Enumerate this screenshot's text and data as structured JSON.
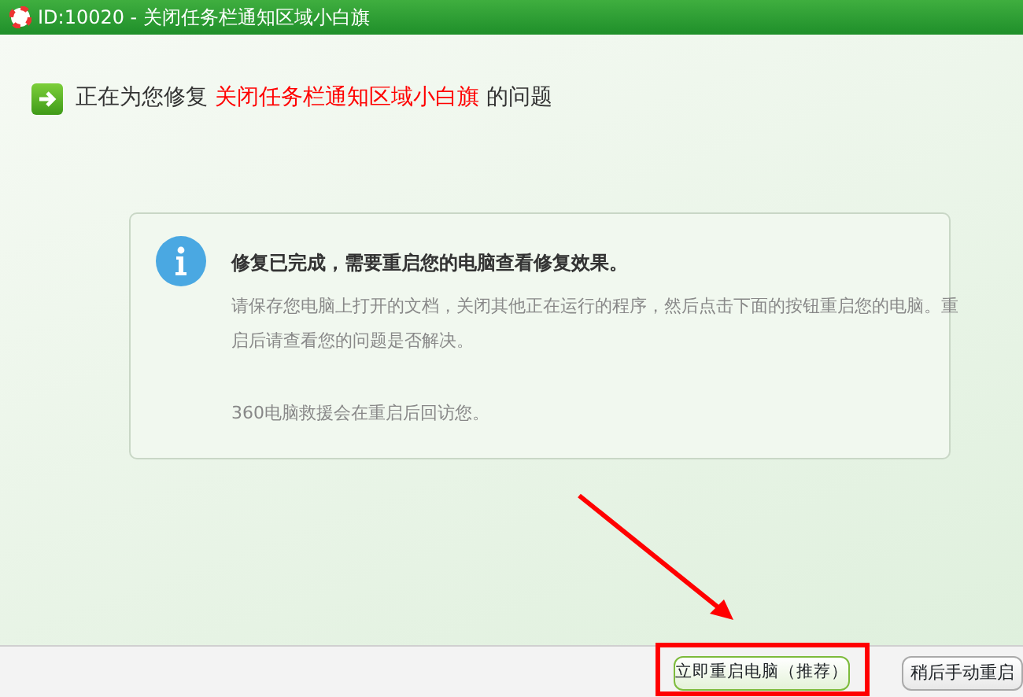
{
  "window": {
    "title": "ID:10020 - 关闭任务栏通知区域小白旗"
  },
  "heading": {
    "prefix": "正在为您修复",
    "issue": "关闭任务栏通知区域小白旗",
    "suffix": "的问题"
  },
  "notice": {
    "title": "修复已完成，需要重启您的电脑查看修复效果。",
    "body": "请保存您电脑上打开的文档，关闭其他正在运行的程序，然后点击下面的按钮重启您的电脑。重启后请查看您的问题是否解决。",
    "note": "360电脑救援会在重启后回访您。"
  },
  "buttons": [
    {
      "label": "立即重启电脑（推荐）",
      "kind": "primary"
    },
    {
      "label": "稍后手动重启",
      "kind": "secondary"
    }
  ]
}
